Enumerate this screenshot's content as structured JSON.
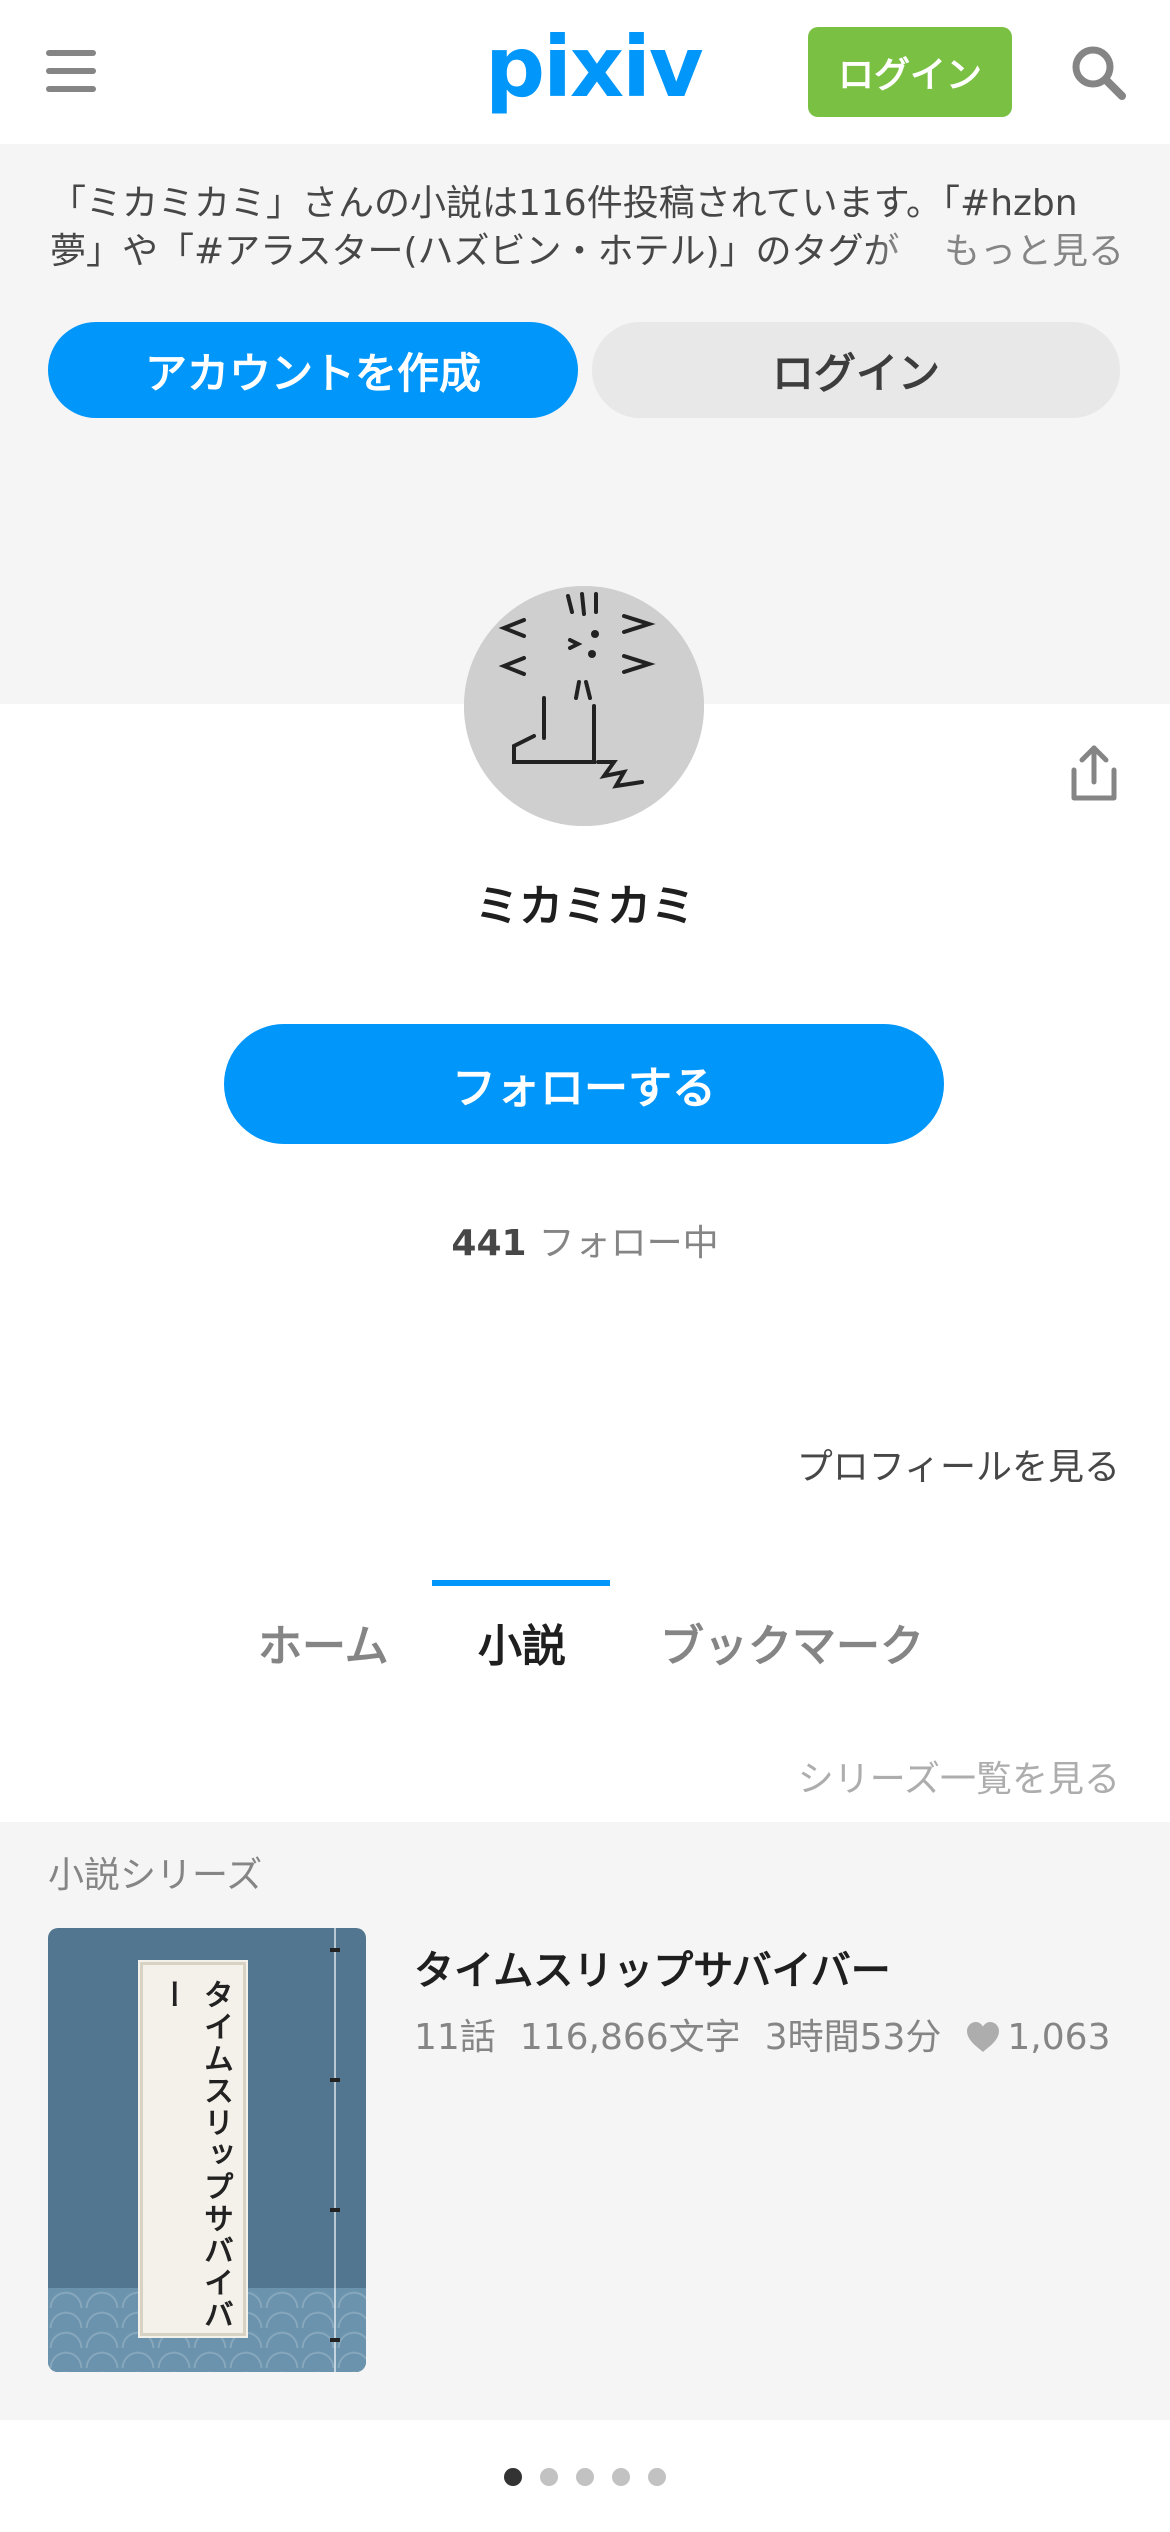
{
  "header": {
    "logo": "pixiv",
    "login_label": "ログイン"
  },
  "intro": {
    "line1": "「ミカミカミ」さんの小説は116件投稿されています。「#hzbn",
    "line2": "夢」や「#アラスター(ハズビン・ホテル)」のタグが",
    "more_label": "もっと見る"
  },
  "cta": {
    "create_account": "アカウントを作成",
    "login": "ログイン"
  },
  "profile": {
    "name": "ミカミカミ",
    "follow_label": "フォローする",
    "following_count": "441",
    "following_label": "フォロー中",
    "profile_link": "プロフィールを見る"
  },
  "tabs": [
    {
      "label": "ホーム",
      "active": false
    },
    {
      "label": "小説",
      "active": true
    },
    {
      "label": "ブックマーク",
      "active": false
    }
  ],
  "series": {
    "list_link": "シリーズ一覧を見る",
    "section_label": "小説シリーズ",
    "cover_title": "タイムスリップサバイバー",
    "title": "タイムスリップサバイバー",
    "episodes": "11話",
    "chars": "116,866文字",
    "reading_time": "3時間53分",
    "likes": "1,063"
  },
  "pagination": {
    "total": 5,
    "current": 1
  },
  "colors": {
    "accent": "#0096fa",
    "login_green": "#7ac143"
  }
}
